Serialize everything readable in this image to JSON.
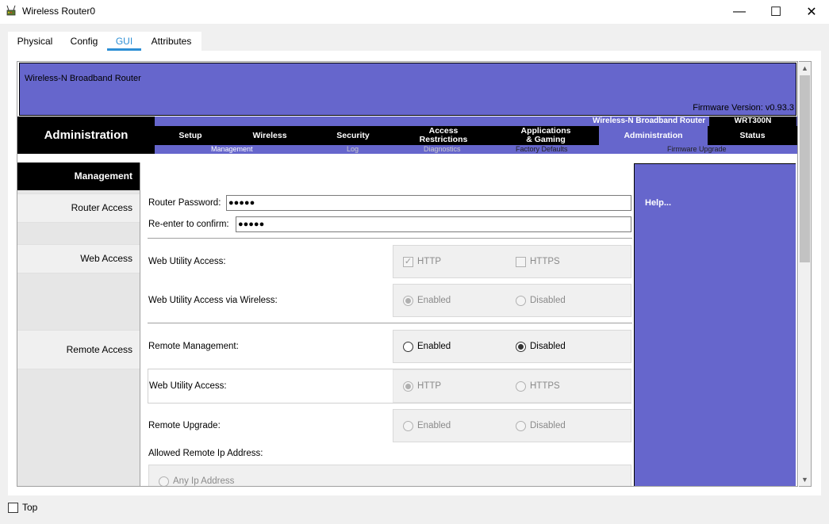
{
  "window": {
    "title": "Wireless Router0",
    "minimize_glyph": "—",
    "maximize_glyph": "☐",
    "close_glyph": "✕"
  },
  "tabs": [
    {
      "label": "Physical"
    },
    {
      "label": "Config"
    },
    {
      "label": "GUI"
    },
    {
      "label": "Attributes"
    }
  ],
  "header": {
    "title": "Wireless-N Broadband Router",
    "firmware": "Firmware Version: v0.93.3"
  },
  "nav": {
    "section": "Administration",
    "brand": "Wireless-N Broadband Router",
    "model": "WRT300N",
    "items": [
      {
        "label": "Setup"
      },
      {
        "label": "Wireless"
      },
      {
        "label": "Security"
      },
      {
        "label": "Access\nRestrictions"
      },
      {
        "label": "Applications\n& Gaming"
      },
      {
        "label": "Administration"
      },
      {
        "label": "Status"
      }
    ],
    "sub_items": [
      {
        "label": "Management"
      },
      {
        "label": "Log"
      },
      {
        "label": "Diagnostics"
      },
      {
        "label": "Factory Defaults"
      },
      {
        "label": "Firmware Upgrade"
      }
    ]
  },
  "sidebar": {
    "title": "Management",
    "items": [
      {
        "label": "Router Access"
      },
      {
        "label": "Web Access"
      },
      {
        "label": "Remote Access"
      }
    ]
  },
  "form": {
    "router_password_label": "Router Password:",
    "router_password_value": "●●●●●",
    "reenter_label": "Re-enter to confirm:",
    "reenter_value": "●●●●●",
    "web_utility_access_label": "Web Utility Access:",
    "http_label": "HTTP",
    "https_label": "HTTPS",
    "wireless_access_label": "Web Utility Access via Wireless:",
    "enabled_label": "Enabled",
    "disabled_label": "Disabled",
    "remote_mgmt_label": "Remote Management:",
    "remote_wua_label": "Web Utility Access:",
    "remote_upgrade_label": "Remote Upgrade:",
    "allowed_ip_label": "Allowed Remote Ip Address:",
    "any_ip_label": "Any Ip Address",
    "http_checked": true,
    "https_checked": false,
    "wireless_access": "Enabled",
    "remote_management": "Disabled",
    "remote_web_utility_access": "HTTP"
  },
  "help": {
    "label": "Help..."
  },
  "footer": {
    "top_label": "Top",
    "top_checked": false
  },
  "colors": {
    "brand_purple": "#6666cc",
    "tab_accent": "#2d8fd5"
  }
}
